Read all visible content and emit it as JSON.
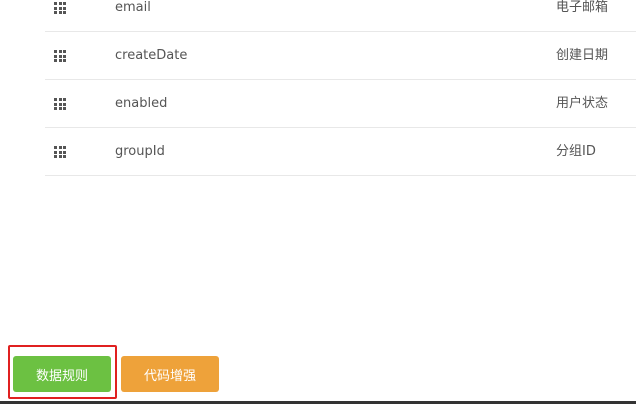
{
  "fields": [
    {
      "name": "email",
      "label": "电子邮箱"
    },
    {
      "name": "createDate",
      "label": "创建日期"
    },
    {
      "name": "enabled",
      "label": "用户状态"
    },
    {
      "name": "groupId",
      "label": "分组ID"
    }
  ],
  "buttons": {
    "data_rules": "数据规则",
    "code_enhance": "代码增强"
  },
  "colors": {
    "data_rules_bg": "#6cc142",
    "code_enhance_bg": "#eea23a",
    "highlight": "#e02020"
  },
  "icons": {
    "drag_handle": "drag-handle-icon"
  }
}
